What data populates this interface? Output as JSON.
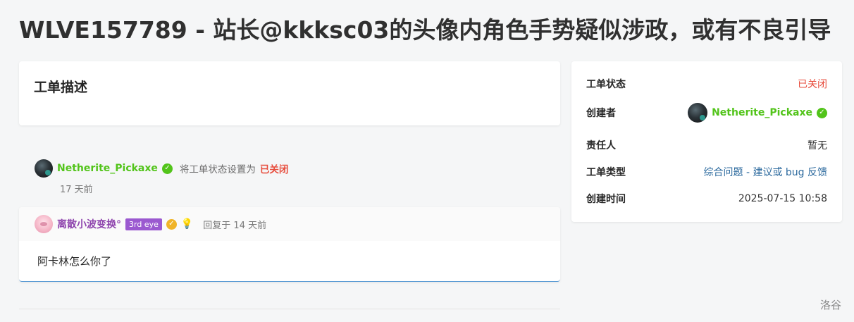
{
  "page": {
    "title": "WLVE157789 - 站长@kkksc03的头像内角色手势疑似涉政，或有不良引导"
  },
  "description": {
    "heading": "工单描述"
  },
  "event": {
    "user": "Netherite_Pickaxe",
    "action": "将工单状态设置为",
    "status": "已关闭",
    "time": "17 天前"
  },
  "reply": {
    "user": "离散小波变换°",
    "badge": "3rd eye",
    "meta": "回复于 14 天前",
    "body": "阿卡林怎么你了"
  },
  "info": {
    "rows": [
      {
        "label": "工单状态",
        "value": "已关闭"
      },
      {
        "label": "创建者",
        "value": "Netherite_Pickaxe"
      },
      {
        "label": "责任人",
        "value": "暂无"
      },
      {
        "label": "工单类型",
        "value": "综合问题 - 建议或 bug 反馈"
      },
      {
        "label": "创建时间",
        "value": "2025-07-15 10:58"
      }
    ]
  },
  "footer": {
    "brand": "洛谷"
  },
  "colors": {
    "accent_green": "#52c41a",
    "closed_red": "#e74c3c",
    "link_blue": "#2c6a9e",
    "user_purple": "#8e44ad"
  },
  "icons": {
    "verified": "check-circle-icon",
    "idea": "lightbulb-icon"
  }
}
